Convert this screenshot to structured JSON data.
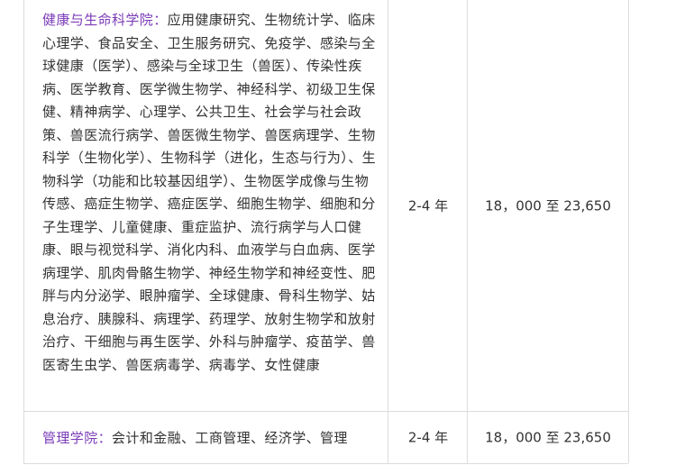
{
  "rows": [
    {
      "school": "健康与生命科学院：",
      "programs": "应用健康研究、生物统计学、临床心理学、食品安全、卫生服务研究、免疫学、感染与全球健康（医学）、感染与全球卫生（兽医）、传染性疾病、医学教育、医学微生物学、神经科学、初级卫生保健、精神病学、心理学、公共卫生、社会学与社会政策、兽医流行病学、兽医微生物学、兽医病理学、生物科学（生物化学）、生物科学（进化，生态与行为）、生物科学（功能和比较基因组学）、生物医学成像与生物传感、癌症生物学、癌症医学、细胞生物学、细胞和分子生理学、儿童健康、重症监护、流行病学与人口健康、眼与视觉科学、消化内科、血液学与白血病、医学病理学、肌肉骨骼生物学、神经生物学和神经变性、肥胖与内分泌学、眼肿瘤学、全球健康、骨科生物学、姑息治疗、胰腺科、病理学、药理学、放射生物学和放射治疗、干细胞与再生医学、外科与肿瘤学、疫苗学、兽医寄生虫学、兽医病毒学、病毒学、女性健康",
      "duration": "2-4 年",
      "tuition": "18，000 至 23,650"
    },
    {
      "school": "管理学院：",
      "programs": "会计和金融、工商管理、经济学、管理",
      "duration": "2-4 年",
      "tuition": "18，000 至 23,650"
    }
  ],
  "colors": {
    "school_label": "#7a3bb8",
    "border": "#dcdcdc",
    "text": "#333333"
  }
}
